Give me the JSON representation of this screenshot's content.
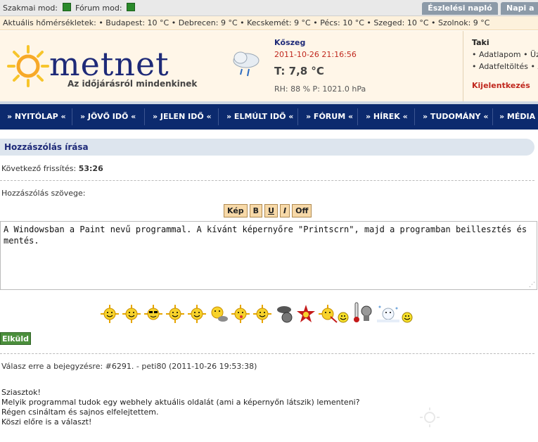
{
  "topbar": {
    "mode1": "Szakmai mod:",
    "mode2": "Fórum mod:",
    "tab1": "Észlelési napló",
    "tab2": "Napi a"
  },
  "temps": "Aktuális hőmérsékletek: • Budapest: 10 °C • Debrecen: 9 °C • Kecskemét: 9 °C • Pécs: 10 °C • Szeged: 10 °C • Szolnok: 9 °C",
  "header": {
    "logo": "metnet",
    "slogan": "Az időjárásról mindenkinek",
    "city": "Kőszeg",
    "time": "2011-10-26 21:16:56",
    "temp": "T: 7,8 °C",
    "rh": "RH: 88 % P: 1021.0 hPa",
    "user": "Taki",
    "link1": "• Adatlapom • Üz",
    "link2": "• Adatfeltöltés • A",
    "logout": "Kijelentkezés"
  },
  "nav": [
    "» NYITÓLAP «",
    "» JÖVŐ IDŐ «",
    "» JELEN IDŐ «",
    "» ELMÚLT IDŐ «",
    "» FÓRUM «",
    "» HÍREK «",
    "» TUDOMÁNY «",
    "» MÉDIA"
  ],
  "form": {
    "title": "Hozzászólás írása",
    "refresh_label": "Következő frissítés:",
    "refresh_value": "53:26",
    "text_label": "Hozzászólás szövege:",
    "buttons": [
      "Kép",
      "B",
      "U",
      "I",
      "Off"
    ],
    "text": "A Windowsban a Paint nevű programmal. A kívánt képernyőre \"Printscrn\", majd a programban beillesztés és mentés.",
    "send": "Elküld"
  },
  "reply": "Válasz erre a bejegyzésre: #6291. - peti80 (2011-10-26 19:53:38)",
  "quote": [
    "Sziasztok!",
    "Melyik programmal tudok egy webhely aktuális oldalát (ami a képernyőn látszik) lementeni?",
    "Régen csináltam és sajnos elfelejtettem.",
    "Köszi előre is a választ!"
  ],
  "colors": {
    "nav": "#0c2a6e",
    "accent": "#c0281e",
    "sun": "#f7c52b"
  },
  "smiley_icons": [
    "sun-smile-icon",
    "sun-smile-icon",
    "sun-sunglasses-icon",
    "sun-smile-icon",
    "sun-smile-icon",
    "sun-cloud-icon",
    "sun-tongue-icon",
    "sun-smile-icon",
    "storm-cloud-icon",
    "red-star-icon",
    "sun-wand-icon",
    "small-smiley-icon",
    "thermometer-icon",
    "snowman-icon",
    "small-smiley-icon"
  ]
}
